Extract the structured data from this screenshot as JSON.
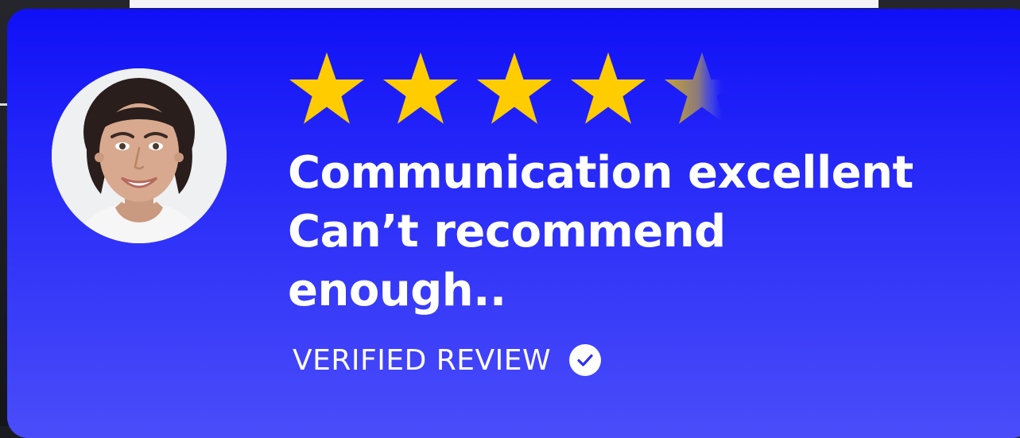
{
  "review": {
    "rating": 4.5,
    "rating_max": 5,
    "headline_lines": [
      "Communication excellent",
      "Can’t recommend",
      "enough.."
    ],
    "verified_label": "VERIFIED REVIEW",
    "icons": {
      "star": "star-icon",
      "check": "check-circle-icon",
      "avatar": "reviewer-avatar"
    }
  },
  "colors": {
    "card_top": "#1010f7",
    "card_bottom": "#4a4df9",
    "star": "#ffcc00",
    "text": "#ffffff"
  }
}
